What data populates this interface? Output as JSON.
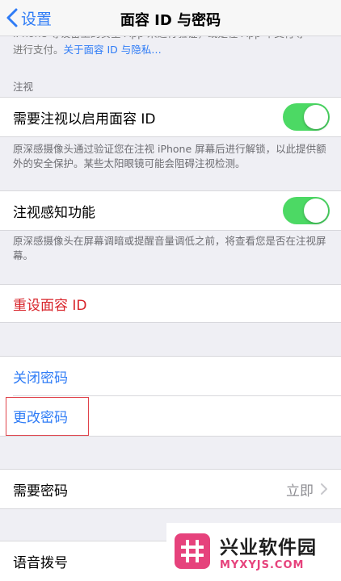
{
  "nav": {
    "back_label": "设置",
    "title": "面容 ID 与密码"
  },
  "top_note": {
    "cut_line": "iPhone 等设备上的安全 App 来进行验证，或是在 App 中支付等",
    "line2": "进行支付。",
    "link": "关于面容 ID 与隐私…"
  },
  "attention": {
    "header": "注视",
    "require_label": "需要注视以启用面容 ID",
    "require_footer": "原深感摄像头通过验证您在注视 iPhone 屏幕后进行解锁，以此提供额外的安全保护。某些太阳眼镜可能会阻碍注视检测。",
    "aware_label": "注视感知功能",
    "aware_footer": "原深感摄像头在屏幕调暗或提醒音量调低之前，将查看您是否在注视屏幕。"
  },
  "reset_face_id": "重设面容 ID",
  "passcode": {
    "turn_off": "关闭密码",
    "change": "更改密码"
  },
  "require_passcode": {
    "label": "需要密码",
    "value": "立即"
  },
  "voice_dial": "语音拨号",
  "watermark": {
    "cn": "兴业软件园",
    "en": "MYXYJS.COM"
  },
  "colors": {
    "accent": "#2f7cf6",
    "toggle_on": "#4cd964",
    "destructive": "#d8242a",
    "highlight": "#e0434b"
  }
}
